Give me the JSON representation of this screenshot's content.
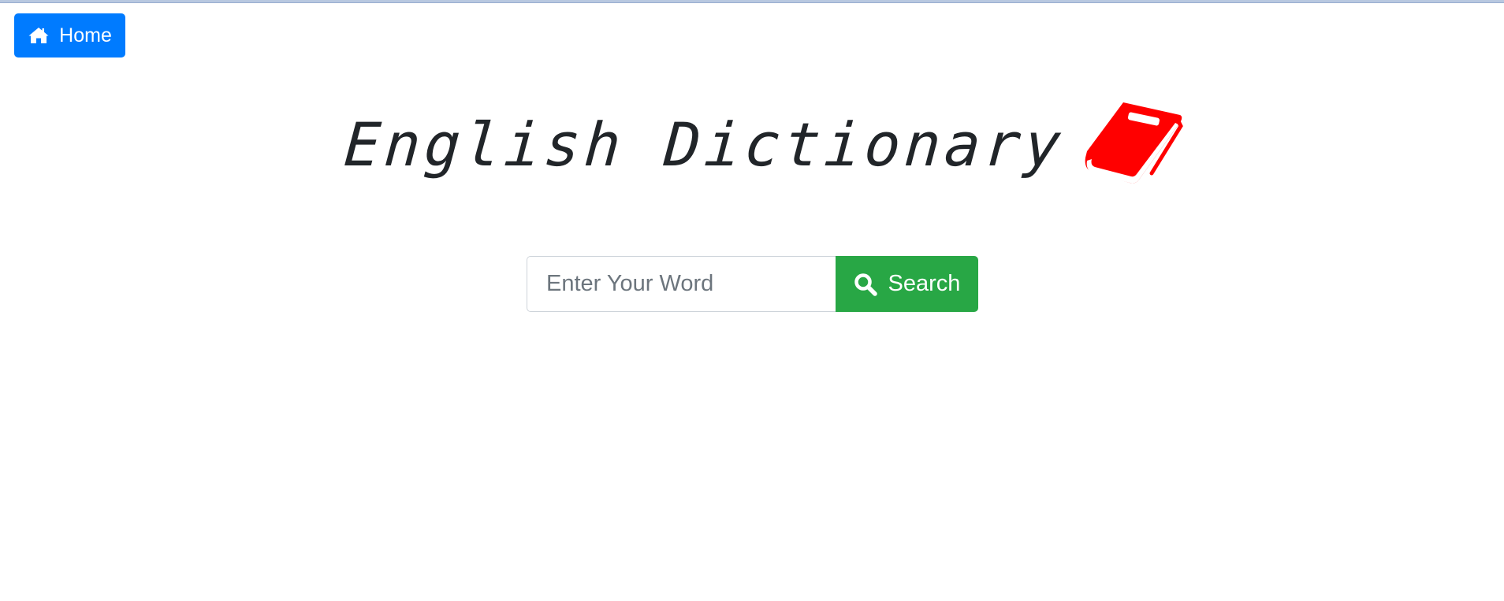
{
  "header": {
    "home_label": "Home",
    "home_icon": "home-icon"
  },
  "hero": {
    "title": "English Dictionary",
    "book_icon": "book-icon",
    "book_color": "#ff0000"
  },
  "search": {
    "placeholder": "Enter Your Word",
    "value": "",
    "button_label": "Search",
    "button_icon": "search-icon"
  },
  "colors": {
    "home_button": "#007bff",
    "search_button": "#28a745",
    "title_text": "#212529"
  }
}
